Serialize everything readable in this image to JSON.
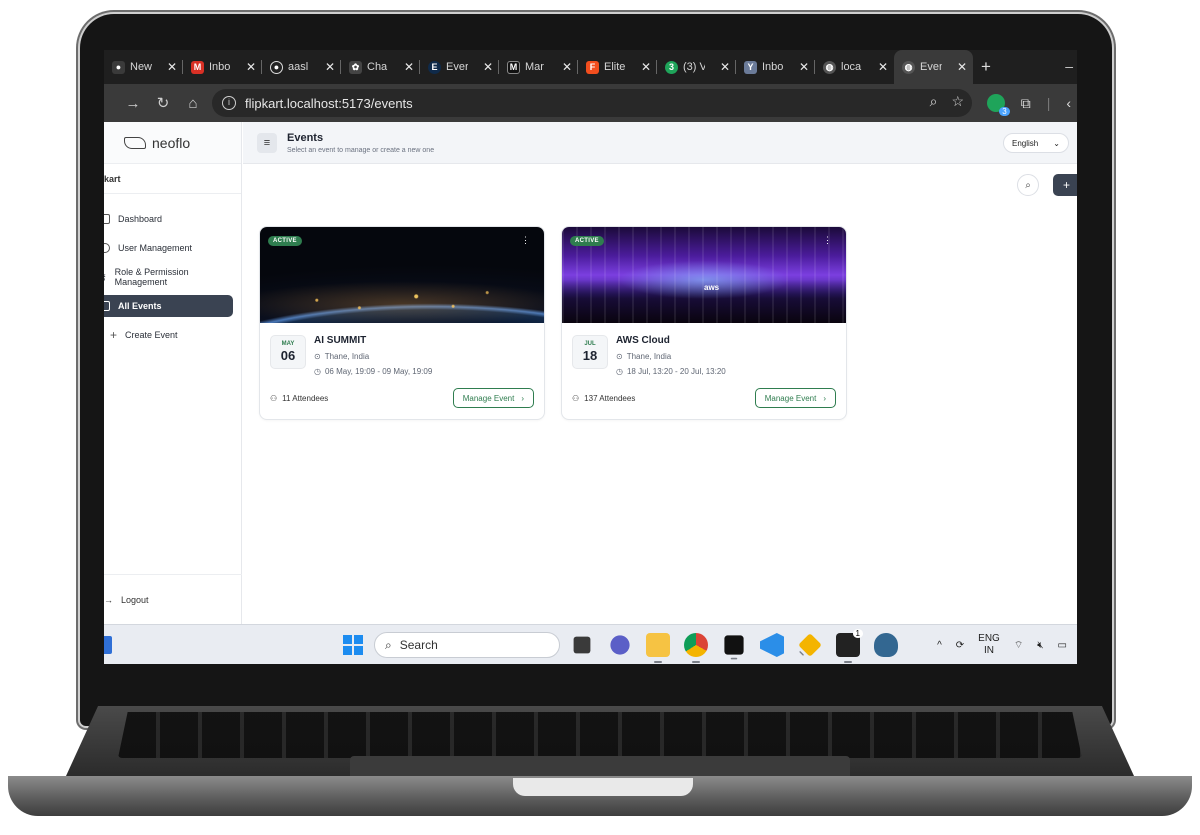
{
  "browser": {
    "tabs": [
      {
        "label": "New",
        "icon": "chrome-icon",
        "color": "#3a3a3a"
      },
      {
        "label": "Inbo",
        "icon": "gmail-icon",
        "color": "#d93025"
      },
      {
        "label": "aasl",
        "icon": "github-icon",
        "color": "#222222"
      },
      {
        "label": "Cha",
        "icon": "chatgpt-icon",
        "color": "#444444"
      },
      {
        "label": "Ever",
        "icon": "eventbrite-icon",
        "color": "#0f2a4a"
      },
      {
        "label": "Mar",
        "icon": "medium-icon",
        "color": "#111111"
      },
      {
        "label": "Elite",
        "icon": "figma-icon",
        "color": "#f24e1e"
      },
      {
        "label": "(3) V",
        "icon": "whatsapp-icon",
        "color": "#1fa45a"
      },
      {
        "label": "Inbo",
        "icon": "yc-icon",
        "color": "#6b7b99"
      },
      {
        "label": "loca",
        "icon": "globe-icon",
        "color": "#555555"
      },
      {
        "label": "Even",
        "icon": "globe-icon",
        "color": "#555555",
        "active": true
      }
    ],
    "url": "flipkart.localhost:5173/events",
    "ext_badge": "3"
  },
  "app": {
    "brand": "neoflo",
    "org": "kart",
    "nav": [
      {
        "label": "Dashboard",
        "icon": "dashboard-icon"
      },
      {
        "label": "User Management",
        "icon": "user-icon"
      },
      {
        "label": "Role & Permission Management",
        "icon": "key-icon"
      },
      {
        "label": "All Events",
        "icon": "calendar-icon",
        "active": true
      },
      {
        "label": "Create Event",
        "icon": "plus-icon"
      }
    ],
    "logout": "Logout",
    "header": {
      "title": "Events",
      "subtitle": "Select an event to manage or create a new one",
      "language": "English"
    },
    "toolbar": {
      "add": "+"
    },
    "events": [
      {
        "status": "ACTIVE",
        "month": "MAY",
        "day": "06",
        "title": "AI SUMMIT",
        "location": "Thane, India",
        "dates": "06 May, 19:09 - 09 May, 19:09",
        "attendees": "11 Attendees",
        "action": "Manage Event"
      },
      {
        "status": "ACTIVE",
        "month": "JUL",
        "day": "18",
        "title": "AWS Cloud",
        "location": "Thane, India",
        "dates": "18 Jul, 13:20 - 20 Jul, 13:20",
        "attendees": "137 Attendees",
        "action": "Manage Event",
        "image_text": "aws"
      }
    ]
  },
  "taskbar": {
    "search": "Search",
    "lang_top": "ENG",
    "lang_bottom": "IN",
    "notification_count": "1"
  },
  "colors": {
    "accent_green": "#2f7d4f",
    "sidebar_active": "#3a4352",
    "browser_bg": "#1f1f1f"
  }
}
